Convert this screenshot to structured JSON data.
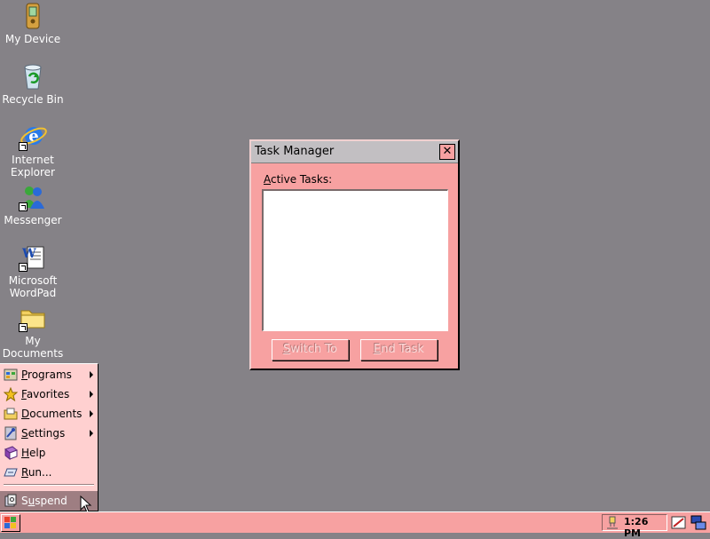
{
  "desktop": {
    "icons": [
      {
        "label_l1": "My Device",
        "label_l2": ""
      },
      {
        "label_l1": "Recycle Bin",
        "label_l2": ""
      },
      {
        "label_l1": "Internet",
        "label_l2": "Explorer"
      },
      {
        "label_l1": "Messenger",
        "label_l2": ""
      },
      {
        "label_l1": "Microsoft",
        "label_l2": "WordPad"
      },
      {
        "label_l1": "My",
        "label_l2": "Documents"
      }
    ]
  },
  "task_manager": {
    "title": "Task Manager",
    "close_glyph": "✕",
    "active_tasks_label_u": "A",
    "active_tasks_label_rest": "ctive Tasks:",
    "switch_to_u": "S",
    "switch_to_rest": "witch To",
    "end_task_u": "E",
    "end_task_rest": "nd Task"
  },
  "start_menu": {
    "items": [
      {
        "u": "P",
        "rest": "rograms",
        "icon": "programs-icon"
      },
      {
        "u": "F",
        "rest": "avorites",
        "icon": "favorites-star-icon"
      },
      {
        "u": "D",
        "rest": "ocuments",
        "icon": "documents-icon"
      },
      {
        "u": "S",
        "rest": "ettings",
        "icon": "settings-icon"
      },
      {
        "u": "H",
        "rest": "elp",
        "icon": "help-book-icon"
      },
      {
        "u": "R",
        "rest": "un...",
        "icon": "run-icon"
      }
    ],
    "suspend": {
      "pre": "S",
      "u": "u",
      "rest": "spend",
      "icon": "suspend-icon"
    }
  },
  "taskbar": {
    "clock": "1:26 PM"
  }
}
